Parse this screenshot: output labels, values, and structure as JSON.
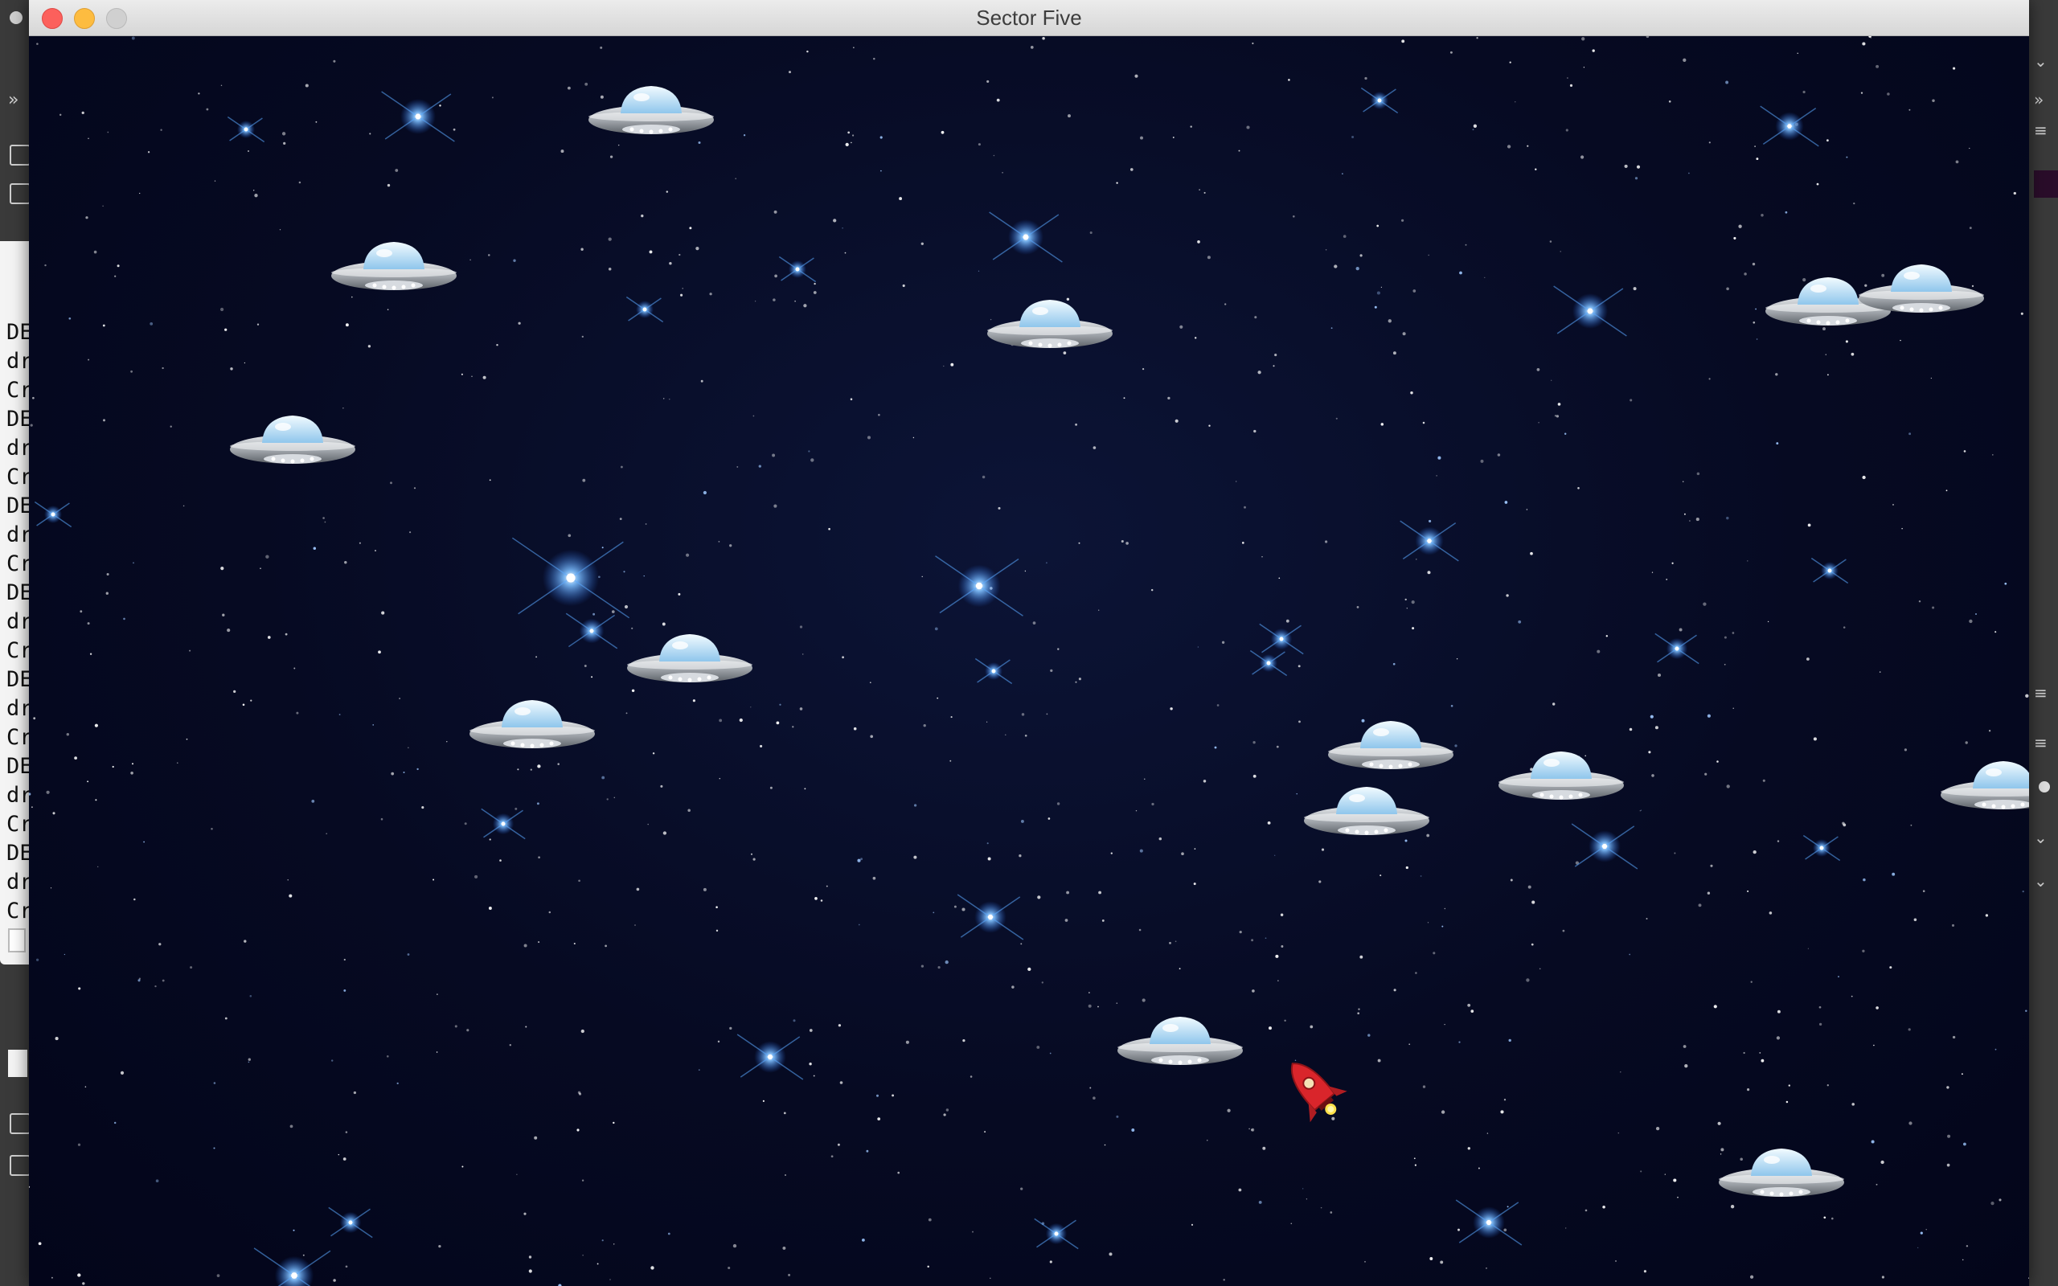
{
  "window": {
    "title": "Sector Five",
    "controls": [
      "close-icon",
      "minimize-icon",
      "maximize-icon"
    ]
  },
  "background_app": {
    "visible_line_fragments": [
      "DE",
      "dr",
      "Cr",
      "DE",
      "dr",
      "Cr",
      "DE",
      "dr",
      "Cr",
      "DE",
      "dr",
      "Cr",
      "DE",
      "dr",
      "Cr",
      "DE",
      "dr",
      "Cr",
      "DE",
      "dr",
      "Cr"
    ]
  },
  "game": {
    "player": {
      "sprite": "red-rocket-ship"
    },
    "enemies": {
      "sprite": "flying-saucer-ufo"
    },
    "background": "starfield",
    "colors": {
      "space": "#060a22",
      "star_blue": "#4fa8ff",
      "rocket": "#d9252b",
      "ufo_dome": "#bfe3ff",
      "ufo_body": "#a8adb3"
    }
  }
}
